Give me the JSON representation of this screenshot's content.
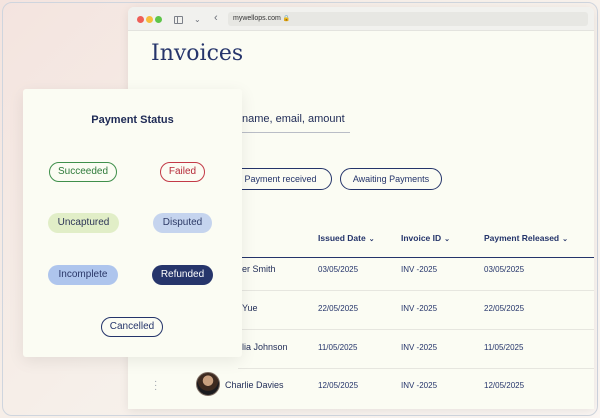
{
  "browser": {
    "url": "mywellops.com"
  },
  "page": {
    "title": "Invoices"
  },
  "search": {
    "placeholder": "name, email, amount"
  },
  "filters": [
    {
      "label": "Payment received"
    },
    {
      "label": "Awaiting Payments"
    }
  ],
  "table": {
    "columns": [
      {
        "label": "Issued Date"
      },
      {
        "label": "Invoice ID"
      },
      {
        "label": "Payment Released"
      }
    ],
    "rows": [
      {
        "name": "er Smith",
        "issued": "03/05/2025",
        "invoice": "INV -2025",
        "released": "03/05/2025"
      },
      {
        "name": "Yue",
        "issued": "22/05/2025",
        "invoice": "INV -2025",
        "released": "22/05/2025"
      },
      {
        "name": "lia Johnson",
        "issued": "11/05/2025",
        "invoice": "INV -2025",
        "released": "11/05/2025"
      },
      {
        "name": "Charlie Davies",
        "issued": "12/05/2025",
        "invoice": "INV -2025",
        "released": "12/05/2025"
      }
    ]
  },
  "status_card": {
    "title": "Payment Status",
    "statuses": {
      "succeeded": "Succeeded",
      "failed": "Failed",
      "uncaptured": "Uncaptured",
      "disputed": "Disputed",
      "incomplete": "Incomplete",
      "refunded": "Refunded",
      "cancelled": "Cancelled"
    }
  },
  "icons": {
    "sort": "chevron-down-icon",
    "drag": "drag-handle-icon",
    "back": "back-arrow-icon",
    "sidebar": "sidebar-toggle-icon",
    "lock": "lock-icon"
  },
  "colors": {
    "primary": "#24346a",
    "succeeded": "#2e7a3a",
    "failed": "#b52a38",
    "uncaptured_bg": "#e1eec7",
    "disputed_bg": "#c5d4ee",
    "incomplete_bg": "#aec5ed",
    "refunded_bg": "#26356b"
  }
}
